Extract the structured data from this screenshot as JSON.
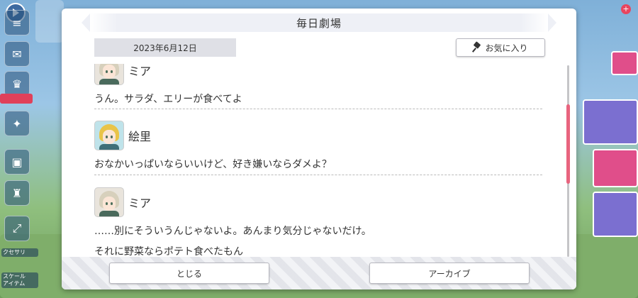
{
  "background": {
    "top_right_text": "",
    "rail_tags": [
      "",
      ""
    ],
    "rail_labels": [
      "クセサリ",
      "スケール\nアイテム"
    ]
  },
  "dialog": {
    "title": "毎日劇場",
    "date": "2023年6月12日",
    "favorite_label": "お気に入り",
    "entries": [
      {
        "speaker": "ミア",
        "avatar": "mia",
        "lines": [
          "うん。サラダ、エリーが食べてよ"
        ]
      },
      {
        "speaker": "絵里",
        "avatar": "eri",
        "lines": [
          "おなかいっぱいならいいけど、好き嫌いならダメよ？"
        ]
      },
      {
        "speaker": "ミア",
        "avatar": "mia",
        "lines": [
          "……別にそういうんじゃないよ。あんまり気分じゃないだけ。",
          "それに野菜ならポテト食べたもん"
        ]
      }
    ],
    "close_label": "とじる",
    "archive_label": "アーカイブ"
  },
  "colors": {
    "accent_scroll": "#e8647e",
    "header_band": "#eef0f6",
    "date_pill": "#dfe0e6"
  },
  "icons": {
    "favorite": "pin-icon",
    "top_left": "play-icon"
  }
}
